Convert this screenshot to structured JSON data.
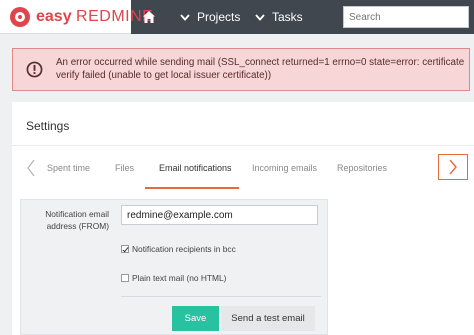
{
  "header": {
    "logo_easy": "easy",
    "logo_redmine": "REDMINE",
    "nav": {
      "home_icon": "home-icon",
      "projects_label": "Projects",
      "tasks_label": "Tasks"
    },
    "search": {
      "placeholder": "Search",
      "value": ""
    }
  },
  "flash": {
    "icon": "error-icon",
    "message": "An error occurred while sending mail (SSL_connect returned=1 errno=0 state=error: certificate verify failed (unable to get local issuer certificate))"
  },
  "settings": {
    "title": "Settings",
    "tabs": [
      {
        "label": "Spent time",
        "active": false
      },
      {
        "label": "Files",
        "active": false
      },
      {
        "label": "Email notifications",
        "active": true
      },
      {
        "label": "Incoming emails",
        "active": false
      },
      {
        "label": "Repositories",
        "active": false
      }
    ],
    "form": {
      "from_label": "Notification email address (FROM)",
      "from_value": "redmine@example.com",
      "bcc_label": "Notification recipients in bcc",
      "bcc_checked": true,
      "plain_label": "Plain text mail (no HTML)",
      "plain_checked": false
    },
    "buttons": {
      "save": "Save",
      "test_email": "Send a test email"
    }
  },
  "colors": {
    "brand_red": "#e0454c",
    "topbar": "#41474f",
    "accent_orange": "#e56a3c",
    "save_green": "#27c3a0",
    "error_bg": "#f6d6d6"
  }
}
